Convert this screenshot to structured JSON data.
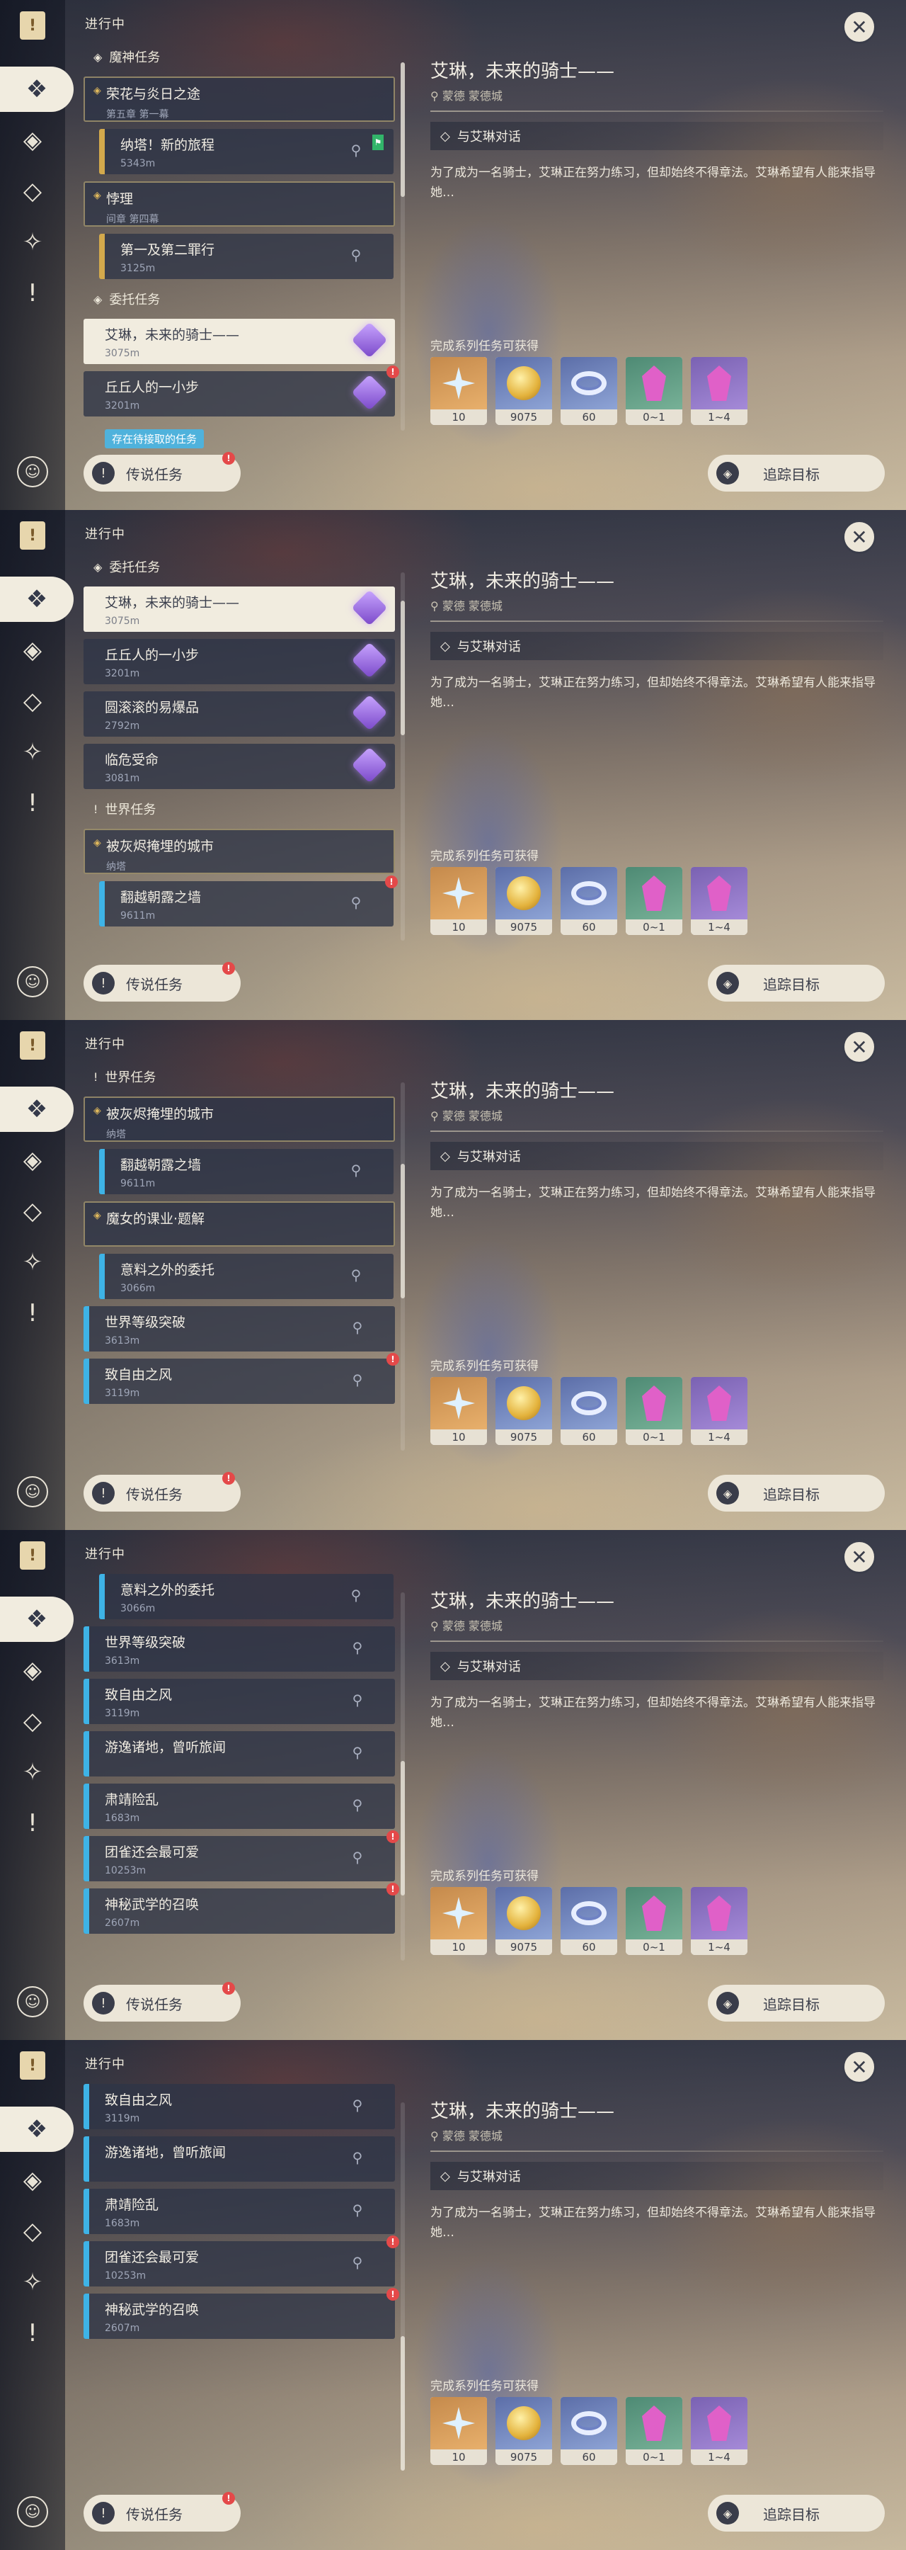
{
  "common": {
    "section_title": "进行中",
    "legend_button": "传说任务",
    "track_button": "追踪目标",
    "close_symbol": "✕",
    "nav_icons": [
      "book-icon",
      "archon-quest-icon",
      "story-quest-icon",
      "world-quest-icon",
      "commission-icon",
      "event-quest-icon",
      "legend-quest-icon"
    ]
  },
  "detail": {
    "title": "艾琳，未来的骑士——",
    "location": "蒙德 蒙德城",
    "step": "与艾琳对话",
    "description": "为了成为一名骑士，艾琳正在努力练习，但却始终不得章法。艾琳希望有人能来指导她…",
    "reward_label": "完成系列任务可获得",
    "rewards": [
      {
        "kind": "primogem",
        "count": "10",
        "color": "orange"
      },
      {
        "kind": "mora",
        "count": "9075",
        "color": "blue"
      },
      {
        "kind": "exp",
        "count": "60",
        "color": "blue"
      },
      {
        "kind": "crystal-green",
        "count": "0~1",
        "color": "green"
      },
      {
        "kind": "crystal-purple",
        "count": "1~4",
        "color": "purple"
      }
    ]
  },
  "screens": [
    {
      "scroll_thumb_pct": 0,
      "tooltip": "存在待接取的任务",
      "items": [
        {
          "type": "category",
          "label": "魔神任务",
          "icon": "◈"
        },
        {
          "type": "card",
          "variant": "parent",
          "title": "荣花与炎日之途",
          "sub": "第五章 第一幕",
          "pin": false
        },
        {
          "type": "card",
          "variant": "child",
          "title": "纳塔！新的旅程",
          "sub": "5343m",
          "pin": true,
          "flag": true
        },
        {
          "type": "card",
          "variant": "parent",
          "title": "悖理",
          "sub": "间章 第四幕",
          "pin": false
        },
        {
          "type": "card",
          "variant": "child",
          "title": "第一及第二罪行",
          "sub": "3125m",
          "pin": true
        },
        {
          "type": "category",
          "label": "委托任务",
          "icon": "◈"
        },
        {
          "type": "card",
          "variant": "selected",
          "title": "艾琳，未来的骑士——",
          "sub": "3075m",
          "gem": true
        },
        {
          "type": "card",
          "variant": "plain",
          "title": "丘丘人的一小步",
          "sub": "3201m",
          "gem": true,
          "redmark": true
        }
      ]
    },
    {
      "scroll_thumb_pct": 0.12,
      "tooltip": "",
      "items": [
        {
          "type": "category",
          "label": "委托任务",
          "icon": "◈"
        },
        {
          "type": "card",
          "variant": "selected",
          "title": "艾琳，未来的骑士——",
          "sub": "3075m",
          "gem": true
        },
        {
          "type": "card",
          "variant": "plain",
          "title": "丘丘人的一小步",
          "sub": "3201m",
          "gem": true
        },
        {
          "type": "card",
          "variant": "plain",
          "title": "圆滚滚的易爆品",
          "sub": "2792m",
          "gem": true
        },
        {
          "type": "card",
          "variant": "plain",
          "title": "临危受命",
          "sub": "3081m",
          "gem": true
        },
        {
          "type": "category",
          "label": "世界任务",
          "icon": "!"
        },
        {
          "type": "card",
          "variant": "parent-blue",
          "title": "被灰烬掩埋的城市",
          "sub": "纳塔",
          "pin": false
        },
        {
          "type": "card",
          "variant": "child-blue",
          "title": "翻越朝露之墙",
          "sub": "9611m",
          "pin": true,
          "redmark": true
        }
      ]
    },
    {
      "scroll_thumb_pct": 0.35,
      "tooltip": "",
      "items": [
        {
          "type": "category",
          "label": "世界任务",
          "icon": "!"
        },
        {
          "type": "card",
          "variant": "parent-blue",
          "title": "被灰烬掩埋的城市",
          "sub": "纳塔",
          "pin": false
        },
        {
          "type": "card",
          "variant": "child-blue",
          "title": "翻越朝露之墙",
          "sub": "9611m",
          "pin": true
        },
        {
          "type": "card",
          "variant": "parent-blue",
          "title": "魔女的课业·题解",
          "sub": "",
          "pin": false
        },
        {
          "type": "card",
          "variant": "child-blue",
          "title": "意料之外的委托",
          "sub": "3066m",
          "pin": true
        },
        {
          "type": "card",
          "variant": "blue",
          "title": "世界等级突破",
          "sub": "3613m",
          "pin": true
        },
        {
          "type": "card",
          "variant": "blue",
          "title": "致自由之风",
          "sub": "3119m",
          "pin": true,
          "redmark": true
        }
      ]
    },
    {
      "scroll_thumb_pct": 0.72,
      "tooltip": "",
      "items": [
        {
          "type": "card",
          "variant": "child-blue",
          "title": "意料之外的委托",
          "sub": "3066m",
          "pin": true
        },
        {
          "type": "card",
          "variant": "blue",
          "title": "世界等级突破",
          "sub": "3613m",
          "pin": true
        },
        {
          "type": "card",
          "variant": "blue",
          "title": "致自由之风",
          "sub": "3119m",
          "pin": true
        },
        {
          "type": "card",
          "variant": "blue",
          "title": "游逸诸地，曾听旅闻",
          "sub": "",
          "pin": true
        },
        {
          "type": "card",
          "variant": "blue",
          "title": "肃靖险乱",
          "sub": "1683m",
          "pin": true
        },
        {
          "type": "card",
          "variant": "blue",
          "title": "团雀还会最可爱",
          "sub": "10253m",
          "pin": true,
          "redmark": true
        },
        {
          "type": "card",
          "variant": "blue",
          "title": "神秘武学的召唤",
          "sub": "2607m",
          "pin": false,
          "redmark": true
        }
      ]
    },
    {
      "scroll_thumb_pct": 1,
      "tooltip": "",
      "items": [
        {
          "type": "card",
          "variant": "blue",
          "title": "致自由之风",
          "sub": "3119m",
          "pin": true
        },
        {
          "type": "card",
          "variant": "blue",
          "title": "游逸诸地，曾听旅闻",
          "sub": "",
          "pin": true
        },
        {
          "type": "card",
          "variant": "blue",
          "title": "肃靖险乱",
          "sub": "1683m",
          "pin": true
        },
        {
          "type": "card",
          "variant": "blue",
          "title": "团雀还会最可爱",
          "sub": "10253m",
          "pin": true,
          "redmark": true
        },
        {
          "type": "card",
          "variant": "blue",
          "title": "神秘武学的召唤",
          "sub": "2607m",
          "pin": false,
          "redmark": true
        }
      ]
    }
  ]
}
